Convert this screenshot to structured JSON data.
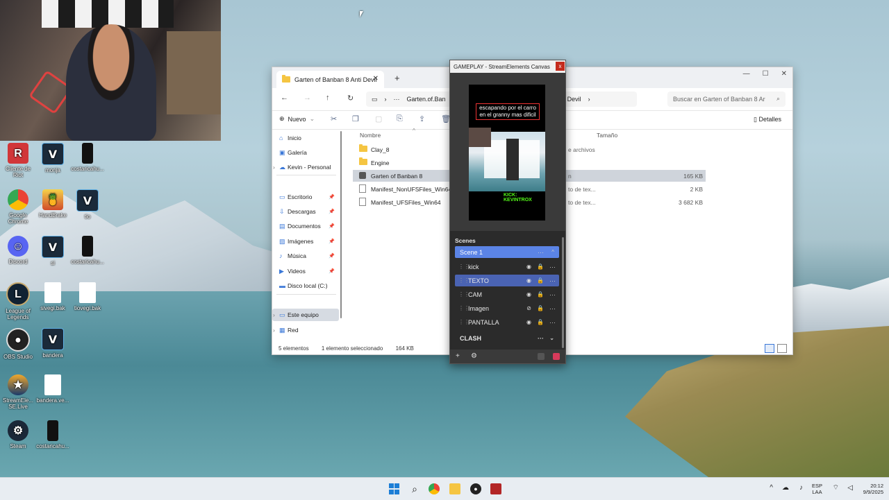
{
  "desktop": {
    "icons": [
      {
        "id": "riot",
        "label": "Cliente de Riot",
        "glyph": "R",
        "cls": "ic-riot"
      },
      {
        "id": "monja",
        "label": "monja",
        "glyph": "V",
        "cls": "ic-vegas"
      },
      {
        "id": "costarica1",
        "label": "costaricahu...",
        "glyph": "",
        "cls": "ic-phone"
      },
      {
        "id": "chrome",
        "label": "Google Chrome",
        "glyph": "",
        "cls": "ic-chrome"
      },
      {
        "id": "handbrake",
        "label": "HandBrake",
        "glyph": "🍍",
        "cls": "ic-handbrake"
      },
      {
        "id": "tio",
        "label": "tio",
        "glyph": "V",
        "cls": "ic-vegas"
      },
      {
        "id": "discord",
        "label": "Discord",
        "glyph": "☺",
        "cls": "ic-discord"
      },
      {
        "id": "si",
        "label": "si",
        "glyph": "V",
        "cls": "ic-vegas"
      },
      {
        "id": "costarica2",
        "label": "costaricahu...",
        "glyph": "",
        "cls": "ic-phone"
      },
      {
        "id": "lol",
        "label": "League of Legends",
        "glyph": "L",
        "cls": "ic-lol"
      },
      {
        "id": "sivegi",
        "label": "sivegi.bak",
        "glyph": "",
        "cls": "ic-file"
      },
      {
        "id": "tiovegi",
        "label": "tiovegi.bak",
        "glyph": "",
        "cls": "ic-file"
      },
      {
        "id": "obs",
        "label": "OBS Studio",
        "glyph": "●",
        "cls": "ic-obs"
      },
      {
        "id": "bandera",
        "label": "bandera",
        "glyph": "V",
        "cls": "ic-vegas"
      },
      {
        "id": "streamelements",
        "label": "StreamEle... SE.Live",
        "glyph": "★",
        "cls": "ic-stream"
      },
      {
        "id": "banderave",
        "label": "bandera.ve...",
        "glyph": "",
        "cls": "ic-file"
      },
      {
        "id": "steam",
        "label": "Steam",
        "glyph": "⚙",
        "cls": "ic-steam"
      },
      {
        "id": "costarica3",
        "label": "costaricahu...",
        "glyph": "",
        "cls": "ic-phone"
      }
    ]
  },
  "explorer": {
    "tab_title": "Garten of Banban 8 Anti Devil",
    "tab_close": "✕",
    "tab_add": "+",
    "address_ellipsis": "···",
    "address_path": "Garten.of.Ban",
    "address_tail": "8 Anti Devil",
    "search_placeholder": "Buscar en Garten of Banban 8 Ar",
    "new_label": "Nuevo",
    "details_label": "Detalles",
    "sidebar": [
      {
        "label": "Inicio",
        "icon": "⌂"
      },
      {
        "label": "Galería",
        "icon": "▣"
      },
      {
        "label": "Kevin - Personal",
        "icon": "☁"
      },
      {
        "label": "Escritorio",
        "icon": "▭"
      },
      {
        "label": "Descargas",
        "icon": "⇩"
      },
      {
        "label": "Documentos",
        "icon": "▤"
      },
      {
        "label": "Imágenes",
        "icon": "▨"
      },
      {
        "label": "Música",
        "icon": "♪"
      },
      {
        "label": "Videos",
        "icon": "▶"
      },
      {
        "label": "Disco local (C:)",
        "icon": "▬"
      },
      {
        "label": "Este equipo",
        "icon": "▭"
      },
      {
        "label": "Red",
        "icon": "▦"
      }
    ],
    "columns": {
      "name": "Nombre",
      "size": "Tamaño"
    },
    "files": [
      {
        "name": "Clay_8",
        "type": "e archivos",
        "size": "",
        "kind": "folder"
      },
      {
        "name": "Engine",
        "type": "",
        "size": "",
        "kind": "folder"
      },
      {
        "name": "Garten of Banban 8",
        "type": "n",
        "size": "165 KB",
        "kind": "exe"
      },
      {
        "name": "Manifest_NonUFSFiles_Win64",
        "type": "to de tex...",
        "size": "2 KB",
        "kind": "doc"
      },
      {
        "name": "Manifest_UFSFiles_Win64",
        "type": "to de tex...",
        "size": "3 682 KB",
        "kind": "doc"
      }
    ],
    "status_count": "5 elementos",
    "status_selected": "1 elemento seleccionado",
    "status_size": "164 KB"
  },
  "se_canvas": {
    "title": "GAMEPLAY - StreamElements Canvas",
    "close": "x",
    "overlay_text": "escapando por el carro en el granny mas dificil",
    "kick_text": "KICK: KEVINTROX",
    "scenes_label": "Scenes",
    "scene1": "Scene 1",
    "sources": [
      {
        "name": "kick",
        "active": false,
        "hidden": false,
        "locked": false
      },
      {
        "name": "TEXTO",
        "active": true,
        "hidden": false,
        "locked": false
      },
      {
        "name": "CAM",
        "active": false,
        "hidden": false,
        "locked": false
      },
      {
        "name": "Imagen",
        "active": false,
        "hidden": true,
        "locked": true
      },
      {
        "name": "PANTALLA",
        "active": false,
        "hidden": false,
        "locked": true
      }
    ],
    "scene2": "CLASH",
    "add_btn": "+",
    "settings_btn": "⚙"
  },
  "taskbar": {
    "lang_top": "ESP",
    "lang_bottom": "LAA",
    "time": "20:12",
    "date": "9/9/2025",
    "colors": {
      "accent": "#1c7ed6"
    }
  }
}
